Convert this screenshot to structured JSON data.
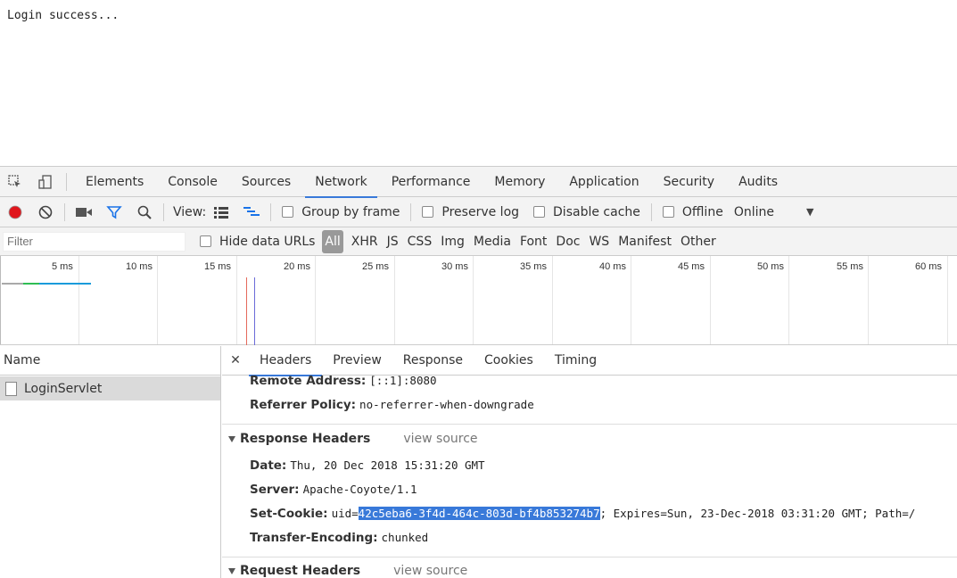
{
  "page": {
    "message": "Login success..."
  },
  "devtools": {
    "tabs": [
      "Elements",
      "Console",
      "Sources",
      "Network",
      "Performance",
      "Memory",
      "Application",
      "Security",
      "Audits"
    ],
    "active_tab": "Network",
    "toolbar": {
      "view_label": "View:",
      "group_by_frame": "Group by frame",
      "preserve_log": "Preserve log",
      "disable_cache": "Disable cache",
      "offline": "Offline",
      "throttle": "Online"
    },
    "filterbar": {
      "placeholder": "Filter",
      "hide_data_urls": "Hide data URLs",
      "types": [
        "All",
        "XHR",
        "JS",
        "CSS",
        "Img",
        "Media",
        "Font",
        "Doc",
        "WS",
        "Manifest",
        "Other"
      ]
    },
    "timeline": {
      "ticks": [
        "5 ms",
        "10 ms",
        "15 ms",
        "20 ms",
        "25 ms",
        "30 ms",
        "35 ms",
        "40 ms",
        "45 ms",
        "50 ms",
        "55 ms",
        "60 ms"
      ]
    },
    "requests": {
      "column_name": "Name",
      "items": [
        "LoginServlet"
      ]
    },
    "detail": {
      "tabs": [
        "Headers",
        "Preview",
        "Response",
        "Cookies",
        "Timing"
      ],
      "active_tab": "Headers",
      "general": [
        {
          "k": "Remote Address:",
          "v": "[::1]:8080"
        },
        {
          "k": "Referrer Policy:",
          "v": "no-referrer-when-downgrade"
        }
      ],
      "response_headers_title": "Response Headers",
      "view_source": "view source",
      "response_headers": {
        "date": {
          "k": "Date:",
          "v": "Thu, 20 Dec 2018 15:31:20 GMT"
        },
        "server": {
          "k": "Server:",
          "v": "Apache-Coyote/1.1"
        },
        "set_cookie": {
          "k": "Set-Cookie:",
          "v_prefix": "uid=",
          "v_highlight": "42c5eba6-3f4d-464c-803d-bf4b853274b7",
          "v_suffix": "; Expires=Sun, 23-Dec-2018 03:31:20 GMT; Path=/"
        },
        "transfer_encoding": {
          "k": "Transfer-Encoding:",
          "v": "chunked"
        }
      },
      "request_headers_title": "Request Headers"
    }
  }
}
